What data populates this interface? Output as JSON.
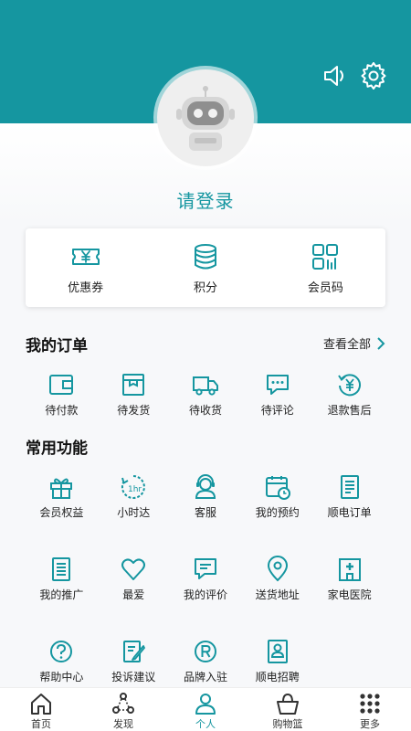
{
  "colors": {
    "accent": "#1596a0",
    "text": "#222222"
  },
  "header": {
    "sound_icon": "speaker-icon",
    "settings_icon": "gear-icon",
    "avatar_icon": "robot-avatar-icon",
    "login_text": "请登录"
  },
  "assets": [
    {
      "label": "优惠券",
      "icon": "coupon-icon"
    },
    {
      "label": "积分",
      "icon": "points-database-icon"
    },
    {
      "label": "会员码",
      "icon": "member-code-icon"
    }
  ],
  "orders": {
    "title": "我的订单",
    "view_all": "查看全部",
    "items": [
      {
        "label": "待付款",
        "icon": "wallet-icon"
      },
      {
        "label": "待发货",
        "icon": "package-box-icon"
      },
      {
        "label": "待收货",
        "icon": "truck-icon"
      },
      {
        "label": "待评论",
        "icon": "comment-bubble-icon"
      },
      {
        "label": "退款售后",
        "icon": "refund-yen-icon"
      }
    ]
  },
  "functions": {
    "title": "常用功能",
    "rows": [
      [
        {
          "label": "会员权益",
          "icon": "gift-icon"
        },
        {
          "label": "小时达",
          "icon": "one-hour-clock-icon"
        },
        {
          "label": "客服",
          "icon": "customer-service-headset-icon"
        },
        {
          "label": "我的预约",
          "icon": "calendar-clock-icon"
        },
        {
          "label": "顺电订单",
          "icon": "order-list-icon"
        }
      ],
      [
        {
          "label": "我的推广",
          "icon": "promotion-list-icon"
        },
        {
          "label": "最爱",
          "icon": "heart-icon"
        },
        {
          "label": "我的评价",
          "icon": "review-edit-icon"
        },
        {
          "label": "送货地址",
          "icon": "location-pin-icon"
        },
        {
          "label": "家电医院",
          "icon": "hospital-icon"
        }
      ],
      [
        {
          "label": "帮助中心",
          "icon": "help-question-icon"
        },
        {
          "label": "投诉建议",
          "icon": "complaint-edit-icon"
        },
        {
          "label": "品牌入驻",
          "icon": "registered-brand-icon"
        },
        {
          "label": "顺电招聘",
          "icon": "recruitment-badge-icon"
        }
      ]
    ]
  },
  "tabbar": [
    {
      "label": "首页",
      "icon": "home-icon",
      "active": false
    },
    {
      "label": "发现",
      "icon": "discover-nodes-icon",
      "active": false
    },
    {
      "label": "个人",
      "icon": "user-profile-icon",
      "active": true
    },
    {
      "label": "购物篮",
      "icon": "shopping-basket-icon",
      "active": false
    },
    {
      "label": "更多",
      "icon": "more-grid-icon",
      "active": false
    }
  ]
}
